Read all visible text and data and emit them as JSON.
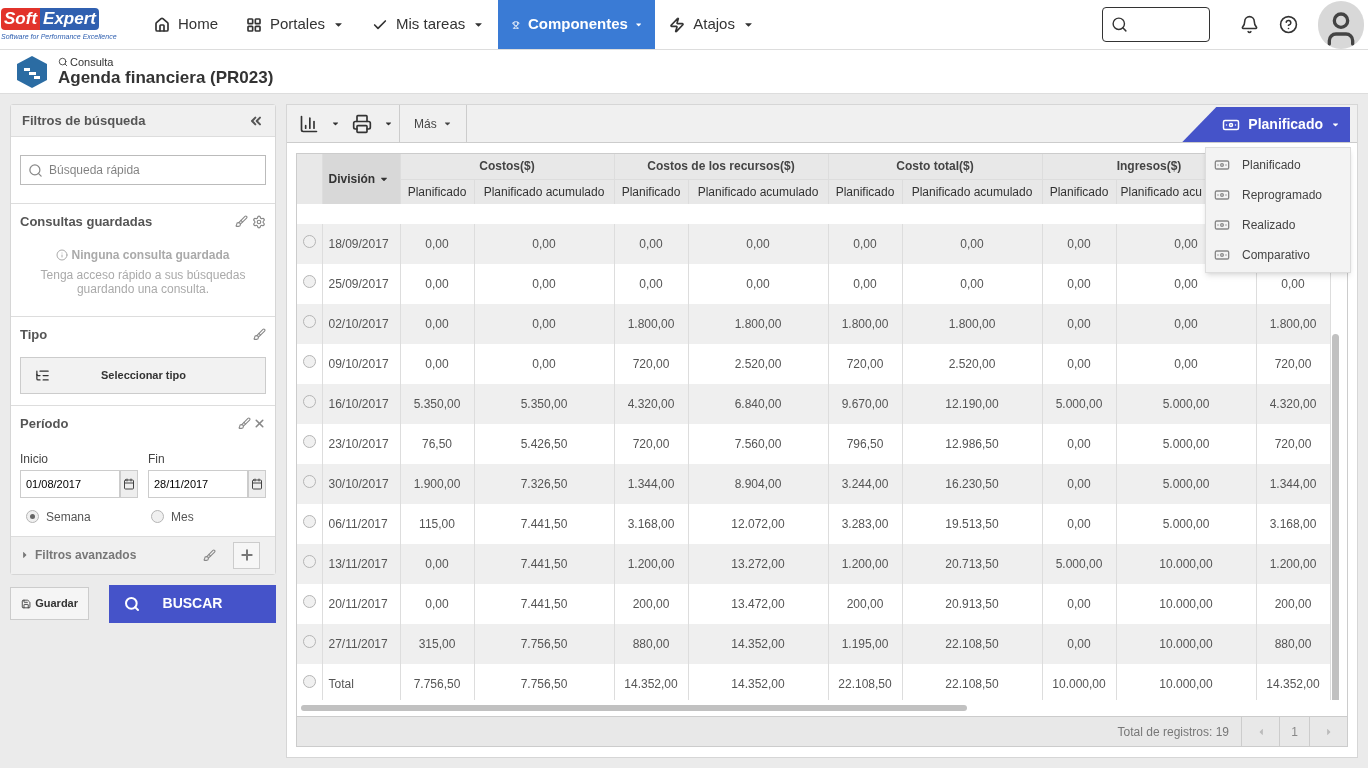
{
  "logo": {
    "word_1": "Soft",
    "word_2": "Expert",
    "tagline": "Software for Performance Excellence"
  },
  "nav": [
    {
      "label": "Home",
      "dropdown": false,
      "selected": false
    },
    {
      "label": "Portales",
      "dropdown": true,
      "selected": false
    },
    {
      "label": "Mis tareas",
      "dropdown": true,
      "selected": false
    },
    {
      "label": "Componentes",
      "dropdown": true,
      "selected": true
    },
    {
      "label": "Atajos",
      "dropdown": true,
      "selected": false
    }
  ],
  "page_header": {
    "breadcrumb": "Consulta",
    "title": "Agenda financiera (PR023)"
  },
  "sidebar": {
    "title": "Filtros de búsqueda",
    "quick_search": {
      "placeholder": "Búsqueda rápida"
    },
    "saved": {
      "title": "Consultas guardadas",
      "empty_title": "Ninguna consulta guardada",
      "empty_text": "Tenga acceso rápido a sus búsquedas guardando una consulta."
    },
    "type": {
      "title": "Tipo",
      "button": "Seleccionar tipo"
    },
    "period": {
      "title": "Período",
      "start_label": "Inicio",
      "start_value": "01/08/2017",
      "end_label": "Fin",
      "end_value": "28/11/2017",
      "options": [
        {
          "label": "Semana",
          "selected": true
        },
        {
          "label": "Mes",
          "selected": false
        }
      ]
    },
    "advanced": {
      "label": "Filtros avanzados",
      "expanded": false
    },
    "save_button": "Guardar",
    "search_button": "BUSCAR"
  },
  "toolbar": {
    "more": "Más",
    "view_button": "Planificado",
    "view_menu": [
      "Planificado",
      "Reprogramado",
      "Realizado",
      "Comparativo"
    ]
  },
  "table": {
    "first_column": "División",
    "groups": [
      {
        "title": "Costos($)",
        "columns": [
          "Planificado",
          "Planificado acumulado"
        ]
      },
      {
        "title": "Costos de los recursos($)",
        "columns": [
          "Planificado",
          "Planificado acumulado"
        ]
      },
      {
        "title": "Costo total($)",
        "columns": [
          "Planificado",
          "Planificado acumulado"
        ]
      },
      {
        "title": "Ingresos($)",
        "columns": [
          "Planificado",
          "Planificado acu"
        ]
      }
    ],
    "rows": [
      {
        "division": "18/09/2017",
        "selected": false,
        "cells": [
          "0,00",
          "0,00",
          "0,00",
          "0,00",
          "0,00",
          "0,00",
          "0,00",
          "0,00",
          null
        ]
      },
      {
        "division": "25/09/2017",
        "selected": false,
        "cells": [
          "0,00",
          "0,00",
          "0,00",
          "0,00",
          "0,00",
          "0,00",
          "0,00",
          "0,00",
          "0,00"
        ]
      },
      {
        "division": "02/10/2017",
        "selected": false,
        "cells": [
          "0,00",
          "0,00",
          "1.800,00",
          "1.800,00",
          "1.800,00",
          "1.800,00",
          "0,00",
          "0,00",
          "1.800,00"
        ]
      },
      {
        "division": "09/10/2017",
        "selected": false,
        "cells": [
          "0,00",
          "0,00",
          "720,00",
          "2.520,00",
          "720,00",
          "2.520,00",
          "0,00",
          "0,00",
          "720,00"
        ]
      },
      {
        "division": "16/10/2017",
        "selected": false,
        "cells": [
          "5.350,00",
          "5.350,00",
          "4.320,00",
          "6.840,00",
          "9.670,00",
          "12.190,00",
          "5.000,00",
          "5.000,00",
          "4.320,00"
        ]
      },
      {
        "division": "23/10/2017",
        "selected": false,
        "cells": [
          "76,50",
          "5.426,50",
          "720,00",
          "7.560,00",
          "796,50",
          "12.986,50",
          "0,00",
          "5.000,00",
          "720,00"
        ]
      },
      {
        "division": "30/10/2017",
        "selected": false,
        "cells": [
          "1.900,00",
          "7.326,50",
          "1.344,00",
          "8.904,00",
          "3.244,00",
          "16.230,50",
          "0,00",
          "5.000,00",
          "1.344,00"
        ]
      },
      {
        "division": "06/11/2017",
        "selected": false,
        "cells": [
          "115,00",
          "7.441,50",
          "3.168,00",
          "12.072,00",
          "3.283,00",
          "19.513,50",
          "0,00",
          "5.000,00",
          "3.168,00"
        ]
      },
      {
        "division": "13/11/2017",
        "selected": false,
        "cells": [
          "0,00",
          "7.441,50",
          "1.200,00",
          "13.272,00",
          "1.200,00",
          "20.713,50",
          "5.000,00",
          "10.000,00",
          "1.200,00"
        ]
      },
      {
        "division": "20/11/2017",
        "selected": false,
        "cells": [
          "0,00",
          "7.441,50",
          "200,00",
          "13.472,00",
          "200,00",
          "20.913,50",
          "0,00",
          "10.000,00",
          "200,00"
        ]
      },
      {
        "division": "27/11/2017",
        "selected": false,
        "cells": [
          "315,00",
          "7.756,50",
          "880,00",
          "14.352,00",
          "1.195,00",
          "22.108,50",
          "0,00",
          "10.000,00",
          "880,00"
        ]
      },
      {
        "division": "Total",
        "selected": false,
        "cells": [
          "7.756,50",
          "7.756,50",
          "14.352,00",
          "14.352,00",
          "22.108,50",
          "22.108,50",
          "10.000,00",
          "10.000,00",
          "14.352,00"
        ]
      }
    ]
  },
  "footer": {
    "total": "Total de registros: 19",
    "page": "1"
  }
}
